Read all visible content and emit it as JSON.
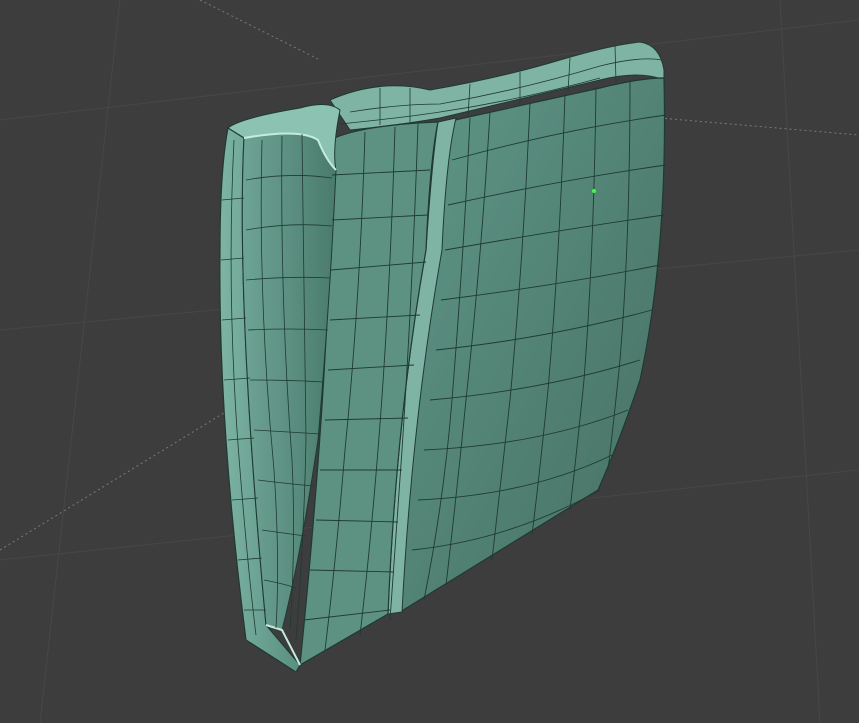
{
  "viewport": {
    "background": "#3d3d3d",
    "grid_color": "#4a4a4a",
    "axis_line_color": "#8a8a8a"
  },
  "mesh": {
    "face_color": "#5b8f7f",
    "face_light": "#7fb3a3",
    "face_dark": "#3f6d60",
    "rim_color": "#b9e3d4",
    "wire_color": "#1f3a33",
    "vertex_color": "#3cff3c"
  }
}
